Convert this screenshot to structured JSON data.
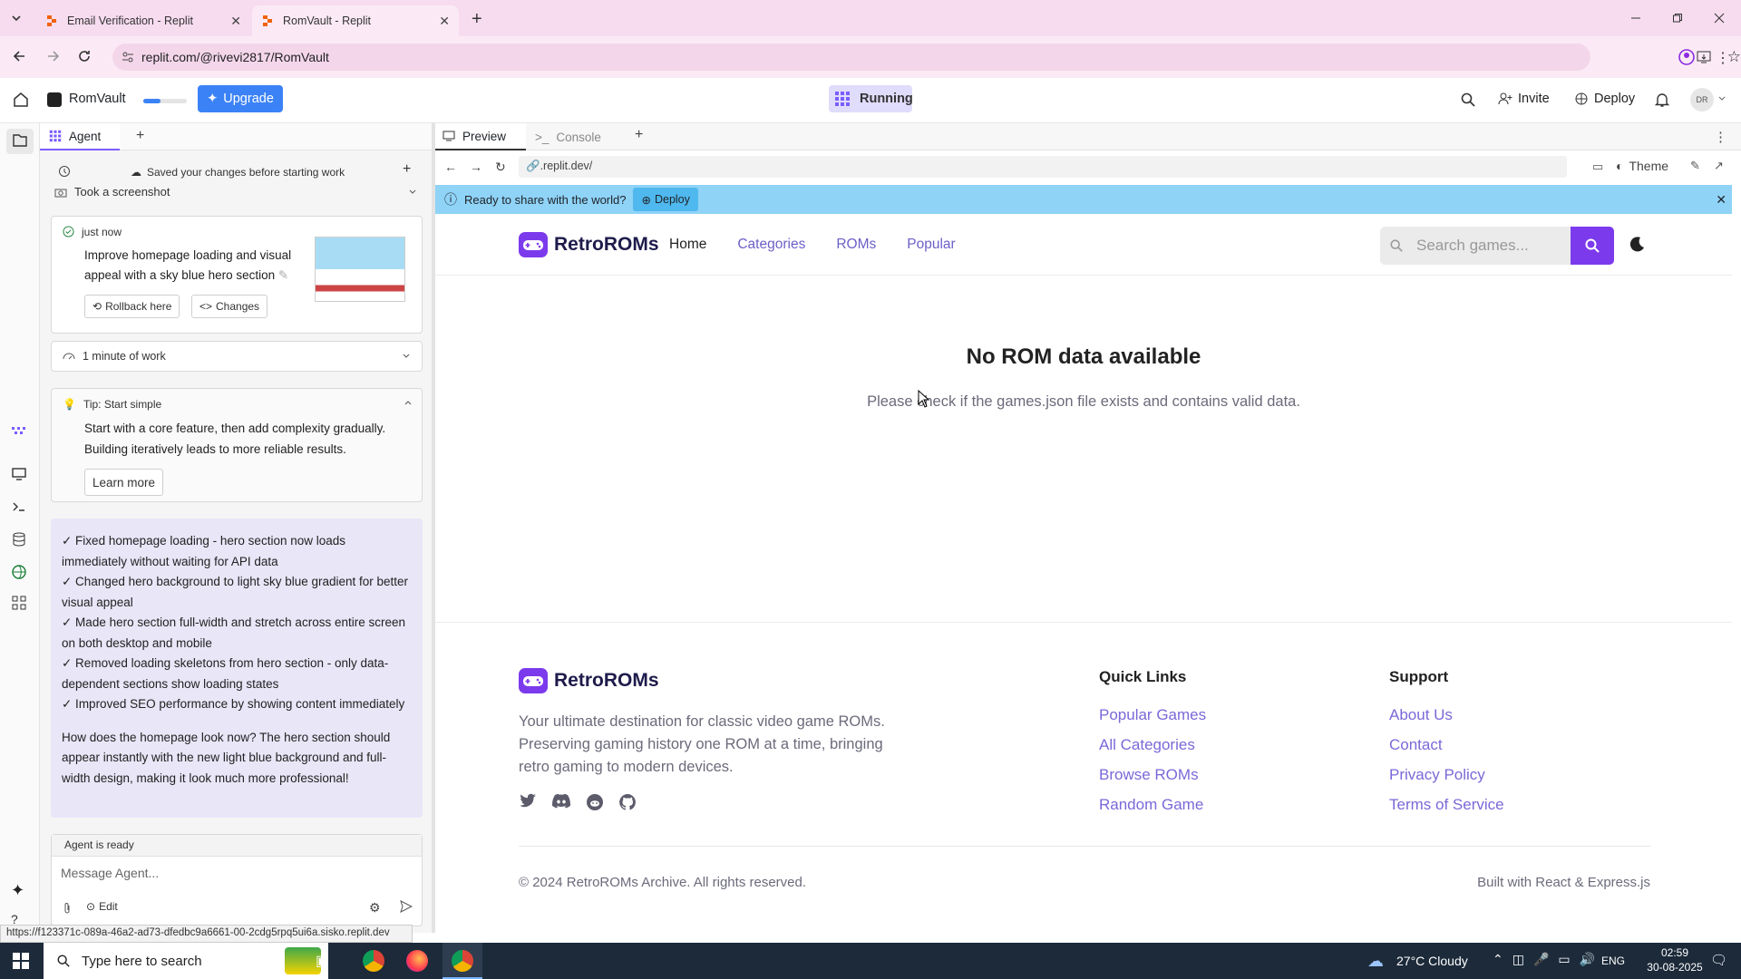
{
  "browser": {
    "tabs": [
      {
        "title": "Email Verification - Replit",
        "active": false
      },
      {
        "title": "RomVault - Replit",
        "active": true
      }
    ],
    "url": "replit.com/@rivevi2817/RomVault"
  },
  "replit": {
    "project_name": "RomVault",
    "upgrade_label": "Upgrade",
    "running_label": "Running",
    "invite_label": "Invite",
    "deploy_label": "Deploy",
    "avatar_initials": "DR"
  },
  "agent": {
    "tab_label": "Agent",
    "saved_note": "Saved your changes before starting work",
    "screenshot_label": "Took a screenshot",
    "checkpoint": {
      "time": "just now",
      "message": "Improve homepage loading and visual appeal with a sky blue hero section",
      "rollback_label": "Rollback here",
      "changes_label": "Changes"
    },
    "work_label": "1 minute of work",
    "tip": {
      "title": "Tip: Start simple",
      "body": "Start with a core feature, then add complexity gradually. Building iteratively leads to more reliable results.",
      "button": "Learn more"
    },
    "message_lines": [
      "✓ Fixed homepage loading - hero section now loads immediately without waiting for API data",
      "✓ Changed hero background to light sky blue gradient for better visual appeal",
      "✓ Made hero section full-width and stretch across entire screen on both desktop and mobile",
      "✓ Removed loading skeletons from hero section - only data-dependent sections show loading states",
      "✓ Improved SEO performance by showing content immediately"
    ],
    "message_question": "How does the homepage look now? The hero section should appear instantly with the new light blue background and full-width design, making it look much more professional!",
    "status": "Agent is ready",
    "input_placeholder": "Message Agent...",
    "edit_label": "Edit"
  },
  "preview": {
    "tabs": [
      "Preview",
      "Console"
    ],
    "url": ".replit.dev/",
    "theme_label": "Theme",
    "banner_text": "Ready to share with the world?",
    "banner_deploy": "Deploy"
  },
  "site": {
    "brand": "RetroROMs",
    "nav": [
      "Home",
      "Categories",
      "ROMs",
      "Popular"
    ],
    "search_placeholder": "Search games...",
    "empty_title": "No ROM data available",
    "empty_body": "Please check if the games.json file exists and contains valid data.",
    "footer": {
      "brand": "RetroROMs",
      "description": "Your ultimate destination for classic video game ROMs. Preserving gaming history one ROM at a time, bringing retro gaming to modern devices.",
      "quick_links_title": "Quick Links",
      "quick_links": [
        "Popular Games",
        "All Categories",
        "Browse ROMs",
        "Random Game"
      ],
      "support_title": "Support",
      "support_links": [
        "About Us",
        "Contact",
        "Privacy Policy",
        "Terms of Service"
      ],
      "copyright": "© 2024 RetroROMs Archive. All rights reserved.",
      "built_with": "Built with React & Express.js"
    }
  },
  "status_url": "https://f123371c-089a-46a2-ad73-dfedbc9a6661-00-2cdg5rpq5ui6a.sisko.replit.dev",
  "taskbar": {
    "search_placeholder": "Type here to search",
    "weather": "27°C  Cloudy",
    "language": "ENG",
    "time": "02:59",
    "date": "30-08-2025"
  },
  "colors": {
    "accent": "#7c3aed",
    "banner": "#8fd3f7",
    "upgrade": "#3b82f6"
  }
}
